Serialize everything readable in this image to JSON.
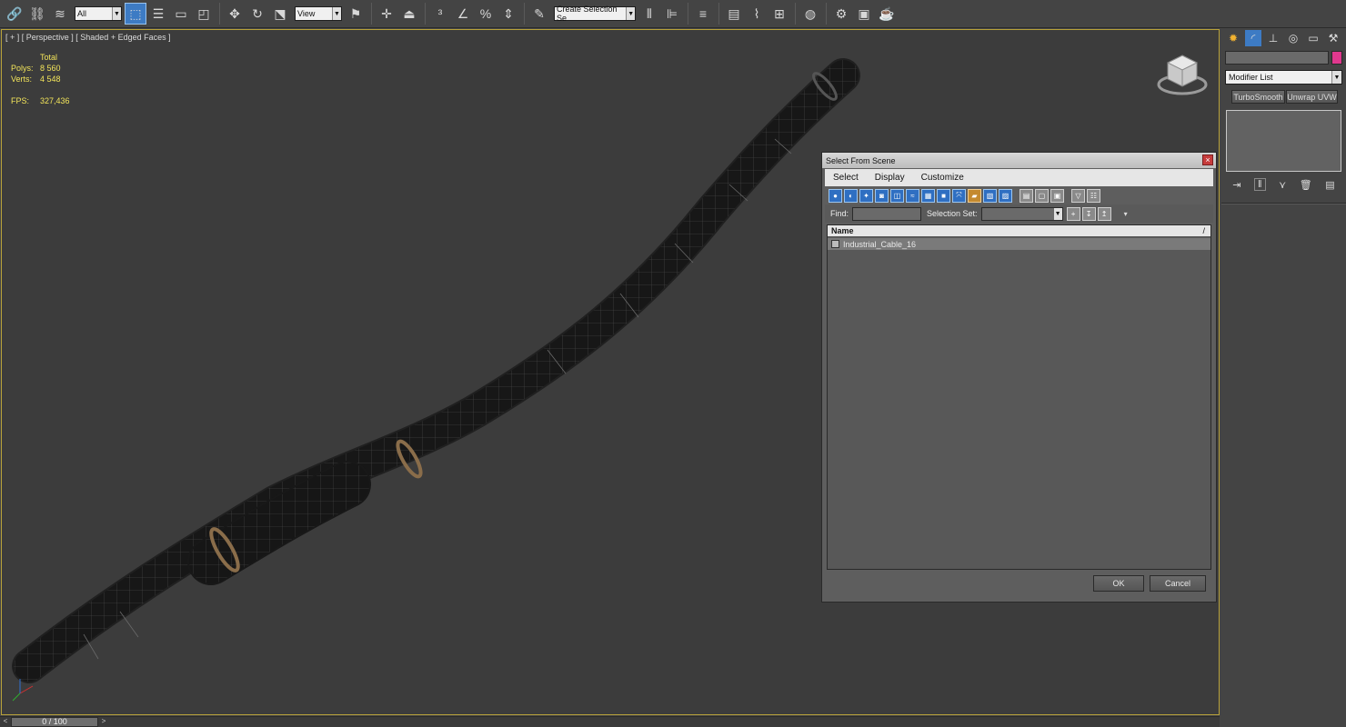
{
  "toolbar": {
    "filter_value": "All",
    "refcoord_value": "View",
    "named_selection_placeholder": "Create Selection Se"
  },
  "viewport": {
    "label": "[ + ] [ Perspective ] [ Shaded + Edged Faces ]",
    "stats": {
      "header": "Total",
      "polys_label": "Polys:",
      "polys_value": "8 560",
      "verts_label": "Verts:",
      "verts_value": "4 548",
      "fps_label": "FPS:",
      "fps_value": "327,436"
    }
  },
  "dialog": {
    "title": "Select From Scene",
    "close": "×",
    "menu": [
      "Select",
      "Display",
      "Customize"
    ],
    "find_label": "Find:",
    "selection_set_label": "Selection Set:",
    "list_header": "Name",
    "sort_indicator": "/",
    "items": [
      "Industrial_Cable_16"
    ],
    "ok_label": "OK",
    "cancel_label": "Cancel"
  },
  "command_panel": {
    "modifier_list": "Modifier List",
    "modifier_buttons": [
      "TurboSmooth",
      "Unwrap UVW"
    ],
    "object_color": "#e0388e"
  },
  "timeslider": {
    "frame_label": "0 / 100",
    "prev": "<",
    "next": ">"
  },
  "colors": {
    "viewport_border": "#b8a23a",
    "stats_text": "#f2e45a",
    "cable_ring": "#8a6d4a",
    "accent_blue": "#3d7bc4"
  }
}
